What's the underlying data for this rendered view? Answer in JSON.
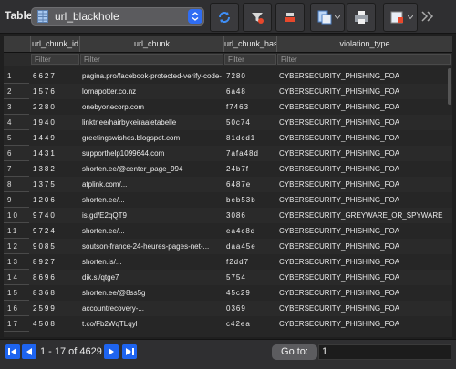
{
  "toolbar": {
    "table_label": "Table:",
    "table_name": "url_blackhole",
    "buttons": [
      {
        "icon": "refresh-icon"
      },
      {
        "icon": "clear-filters-icon"
      },
      {
        "icon": "delete-record-icon"
      },
      {
        "icon": "save-changes-icon"
      },
      {
        "icon": "print-icon"
      },
      {
        "icon": "new-record-icon"
      },
      {
        "icon": "more-chevron-icon"
      }
    ]
  },
  "columns": [
    "url_chunk_id",
    "url_chunk",
    "url_chunk_hash",
    "violation_type"
  ],
  "filter_placeholder": "Filter",
  "rows": [
    {
      "n": "1",
      "id": "6627",
      "chunk": "pagina.pro/facebook-protected-verify-code-",
      "hash": "7280",
      "type": "CYBERSECURITY_PHISHING_FOA"
    },
    {
      "n": "2",
      "id": "1576",
      "chunk": "lornapotter.co.nz",
      "hash": "6a48",
      "type": "CYBERSECURITY_PHISHING_FOA"
    },
    {
      "n": "3",
      "id": "2280",
      "chunk": "onebyonecorp.com",
      "hash": "f7463",
      "type": "CYBERSECURITY_PHISHING_FOA"
    },
    {
      "n": "4",
      "id": "1940",
      "chunk": "linktr.ee/hairbykeiraaletabelle",
      "hash": "50c74",
      "type": "CYBERSECURITY_PHISHING_FOA"
    },
    {
      "n": "5",
      "id": "1449",
      "chunk": "greetingswishes.blogspot.com",
      "hash": "81dcd1",
      "type": "CYBERSECURITY_PHISHING_FOA"
    },
    {
      "n": "6",
      "id": "1431",
      "chunk": "supporthelp1099644.com",
      "hash": "7afa48d",
      "type": "CYBERSECURITY_PHISHING_FOA"
    },
    {
      "n": "7",
      "id": "1382",
      "chunk": "shorten.ee/@center_page_994",
      "hash": "24b7f",
      "type": "CYBERSECURITY_PHISHING_FOA"
    },
    {
      "n": "8",
      "id": "1375",
      "chunk": "atplink.com/...",
      "hash": "6487e",
      "type": "CYBERSECURITY_PHISHING_FOA"
    },
    {
      "n": "9",
      "id": "1206",
      "chunk": "shorten.ee/...",
      "hash": "beb53b",
      "type": "CYBERSECURITY_PHISHING_FOA"
    },
    {
      "n": "10",
      "id": "9740",
      "chunk": "is.gd/E2qQT9",
      "hash": "3086",
      "type": "CYBERSECURITY_GREYWARE_OR_SPYWARE"
    },
    {
      "n": "11",
      "id": "9724",
      "chunk": "shorten.ee/...",
      "hash": "ea4c8d",
      "type": "CYBERSECURITY_PHISHING_FOA"
    },
    {
      "n": "12",
      "id": "9085",
      "chunk": "soutson-france-24-heures-pages-net-...",
      "hash": "daa45e",
      "type": "CYBERSECURITY_PHISHING_FOA"
    },
    {
      "n": "13",
      "id": "8927",
      "chunk": "shorten.is/...",
      "hash": "f2dd7",
      "type": "CYBERSECURITY_PHISHING_FOA"
    },
    {
      "n": "14",
      "id": "8696",
      "chunk": "dik.si/qtge7",
      "hash": "5754",
      "type": "CYBERSECURITY_PHISHING_FOA"
    },
    {
      "n": "15",
      "id": "8368",
      "chunk": "shorten.ee/@8ss5g",
      "hash": "45c29",
      "type": "CYBERSECURITY_PHISHING_FOA"
    },
    {
      "n": "16",
      "id": "2599",
      "chunk": "accountrecovery-...",
      "hash": "0369",
      "type": "CYBERSECURITY_PHISHING_FOA"
    },
    {
      "n": "17",
      "id": "4508",
      "chunk": "t.co/Fb2WqTLqyl",
      "hash": "c42ea",
      "type": "CYBERSECURITY_PHISHING_FOA"
    }
  ],
  "pager": {
    "range_text": "1 - 17 of 4629",
    "goto_label": "Go to:",
    "goto_value": "1"
  },
  "colors": {
    "accent": "#1e64f0",
    "toolbar_bg": "#2f2f31",
    "grid_bg": "#262626"
  }
}
